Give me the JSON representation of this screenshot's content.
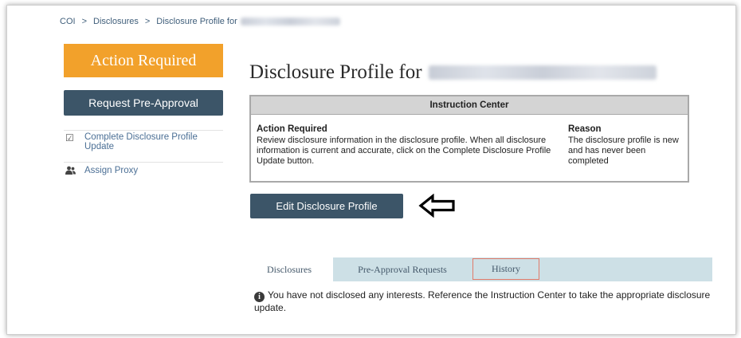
{
  "breadcrumb": {
    "items": [
      "COI",
      "Disclosures",
      "Disclosure Profile for"
    ],
    "separator": ">"
  },
  "sidebar": {
    "action_required": "Action Required",
    "request_pre_approval": "Request Pre-Approval",
    "items": [
      {
        "label": "Complete Disclosure Profile Update",
        "icon": "checkbox-icon"
      },
      {
        "label": "Assign Proxy",
        "icon": "user-group-icon"
      }
    ]
  },
  "main": {
    "title": "Disclosure Profile for",
    "instruction_center": {
      "header": "Instruction Center",
      "action_heading": "Action Required",
      "action_text": "Review disclosure information in the disclosure profile. When all disclosure information is current and accurate, click on the Complete Disclosure Profile Update button.",
      "reason_heading": "Reason",
      "reason_text": "The disclosure profile is new and has never been completed"
    },
    "edit_button": "Edit Disclosure Profile",
    "tabs": [
      {
        "label": "Disclosures",
        "active": true
      },
      {
        "label": "Pre-Approval Requests",
        "active": false
      },
      {
        "label": "History",
        "active": false,
        "highlighted": true
      }
    ],
    "notice": "You have not disclosed any interests. Reference the Instruction Center to take the appropriate disclosure update."
  },
  "colors": {
    "action_required_bg": "#f2a12b",
    "button_bg": "#3c5568",
    "link": "#4b6f95",
    "tabbar_bg": "#cde0e6",
    "highlight_border": "#e07a6a"
  }
}
